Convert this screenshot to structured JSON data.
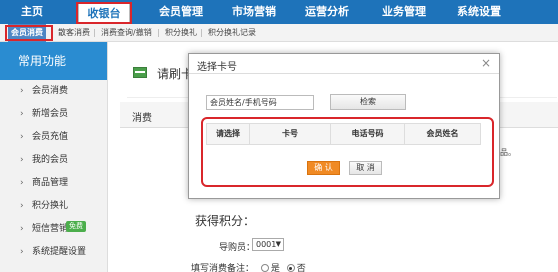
{
  "top_nav": {
    "items": [
      "主页",
      "收银台",
      "会员管理",
      "市场营销",
      "运营分析",
      "业务管理",
      "系统设置"
    ],
    "active_index": 1
  },
  "sub_nav": {
    "items": [
      "会员消费",
      "散客消费",
      "消费查询/撤销",
      "积分换礼",
      "积分换礼记录"
    ],
    "separator": "|"
  },
  "sidebar": {
    "title": "常用功能",
    "chevron": "›",
    "items": [
      {
        "label": "会员消费"
      },
      {
        "label": "新增会员"
      },
      {
        "label": "会员充值"
      },
      {
        "label": "我的会员"
      },
      {
        "label": "商品管理"
      },
      {
        "label": "积分换礼"
      },
      {
        "label": "短信营销",
        "badge": "免费"
      },
      {
        "label": "系统提醒设置"
      }
    ]
  },
  "main": {
    "swipe_title": "请刷卡或",
    "consume_tab": "消费",
    "side_note": "惠商品。",
    "points_label": "获得积分：",
    "guide_label": "导购员：",
    "guide_value": "0001",
    "remark_label": "填写消费备注：",
    "remark_options": [
      "是",
      "否"
    ],
    "remark_selected": "否"
  },
  "modal": {
    "title": "选择卡号",
    "close": "×",
    "search_value": "会员姓名/手机号码",
    "search_button": "检索",
    "columns": [
      "请选择",
      "卡号",
      "电话号码",
      "会员姓名"
    ],
    "ok_button": "确 认",
    "cancel_button": "取 消"
  },
  "colors": {
    "nav_blue": "#1e73ba",
    "highlight_red": "#d9262b",
    "confirm_orange": "#f08a24",
    "free_badge_green": "#4cae4c"
  }
}
